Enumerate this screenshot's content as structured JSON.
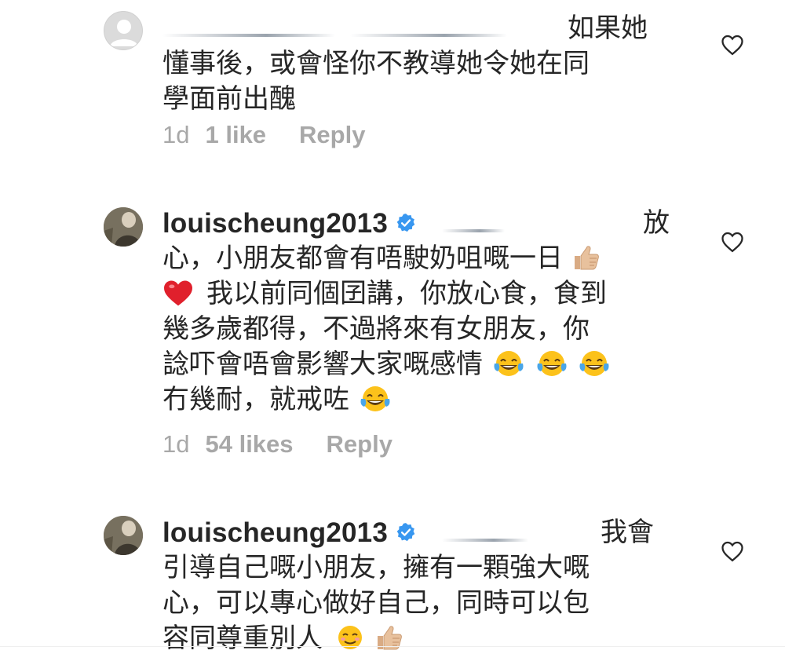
{
  "comments": [
    {
      "username": "",
      "end_word": "如果她",
      "lines": [
        "懂事後，或會怪你不教導她令她在同",
        "學面前出醜"
      ],
      "time": "1d",
      "likes": "1 like",
      "reply": "Reply"
    },
    {
      "username": "louischeung2013",
      "end_word": "放",
      "lines": [
        "心，小朋友都會有唔駛奶咀嘅一日",
        "我以前同個囝講，你放心食，食到",
        "幾多歲都得，不過將來有女朋友，你",
        "諗吓會唔會影響大家嘅感情",
        "冇幾耐，就戒咗"
      ],
      "time": "1d",
      "likes": "54 likes",
      "reply": "Reply"
    },
    {
      "username": "louischeung2013",
      "end_word": "我會",
      "lines": [
        "引導自己嘅小朋友，擁有一顆強大嘅",
        "心，可以專心做好自己，同時可以包",
        "容同尊重別人"
      ]
    }
  ],
  "icons": {
    "heart": "heart-outline-icon",
    "verified": "verified-badge-icon",
    "thumbs_up": "thumbs-up-emoji",
    "red_heart": "red-heart-emoji",
    "tears_of_joy": "tears-of-joy-emoji",
    "smiling": "smiling-face-emoji"
  },
  "colors": {
    "text": "#262626",
    "meta": "#a8a8a8",
    "verified": "#3897f0",
    "heart_outline": "#262626"
  }
}
